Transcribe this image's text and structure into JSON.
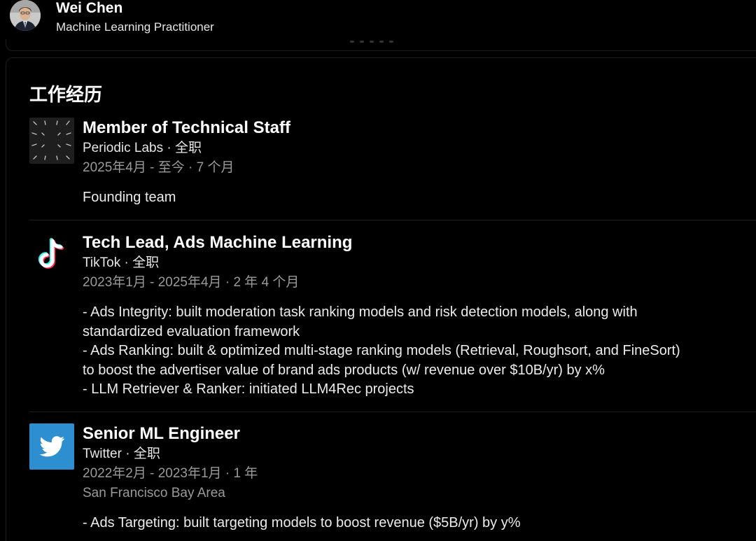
{
  "profile": {
    "name": "Wei Chen",
    "headline": "Machine Learning Practitioner",
    "avatar_icon": "person-avatar"
  },
  "experience": {
    "section_title": "工作经历",
    "items": [
      {
        "title": "Member of Technical Staff",
        "company_line": "Periodic Labs · 全职",
        "dates": "2025年4月 - 至今 · 7 个月",
        "location": "",
        "logo_icon": "periodic-labs-logo",
        "description": [
          "Founding team"
        ]
      },
      {
        "title": "Tech Lead, Ads Machine Learning",
        "company_line": "TikTok · 全职",
        "dates": "2023年1月 - 2025年4月 · 2 年 4 个月",
        "location": "",
        "logo_icon": "tiktok-logo",
        "description": [
          "- Ads Integrity: built moderation task ranking models and risk detection models, along with",
          "standardized evaluation framework",
          "- Ads Ranking: built & optimized multi-stage ranking models (Retrieval, Roughsort, and FineSort)",
          "to boost the advertiser value of brand ads products (w/ revenue over $10B/yr) by x%",
          "- LLM Retriever & Ranker: initiated LLM4Rec projects"
        ]
      },
      {
        "title": "Senior ML Engineer",
        "company_line": "Twitter · 全职",
        "dates": "2022年2月 - 2023年1月 · 1 年",
        "location": "San Francisco Bay Area",
        "logo_icon": "twitter-logo",
        "description": [
          "- Ads Targeting: built targeting models to boost revenue ($5B/yr) by y%"
        ]
      }
    ]
  },
  "colors": {
    "background": "#000000",
    "text_primary": "#ffffff",
    "text_secondary": "#9a9a9a",
    "twitter_blue": "#2d8fd0",
    "tiktok_cyan": "#25f4ee",
    "tiktok_red": "#fe2c55"
  }
}
